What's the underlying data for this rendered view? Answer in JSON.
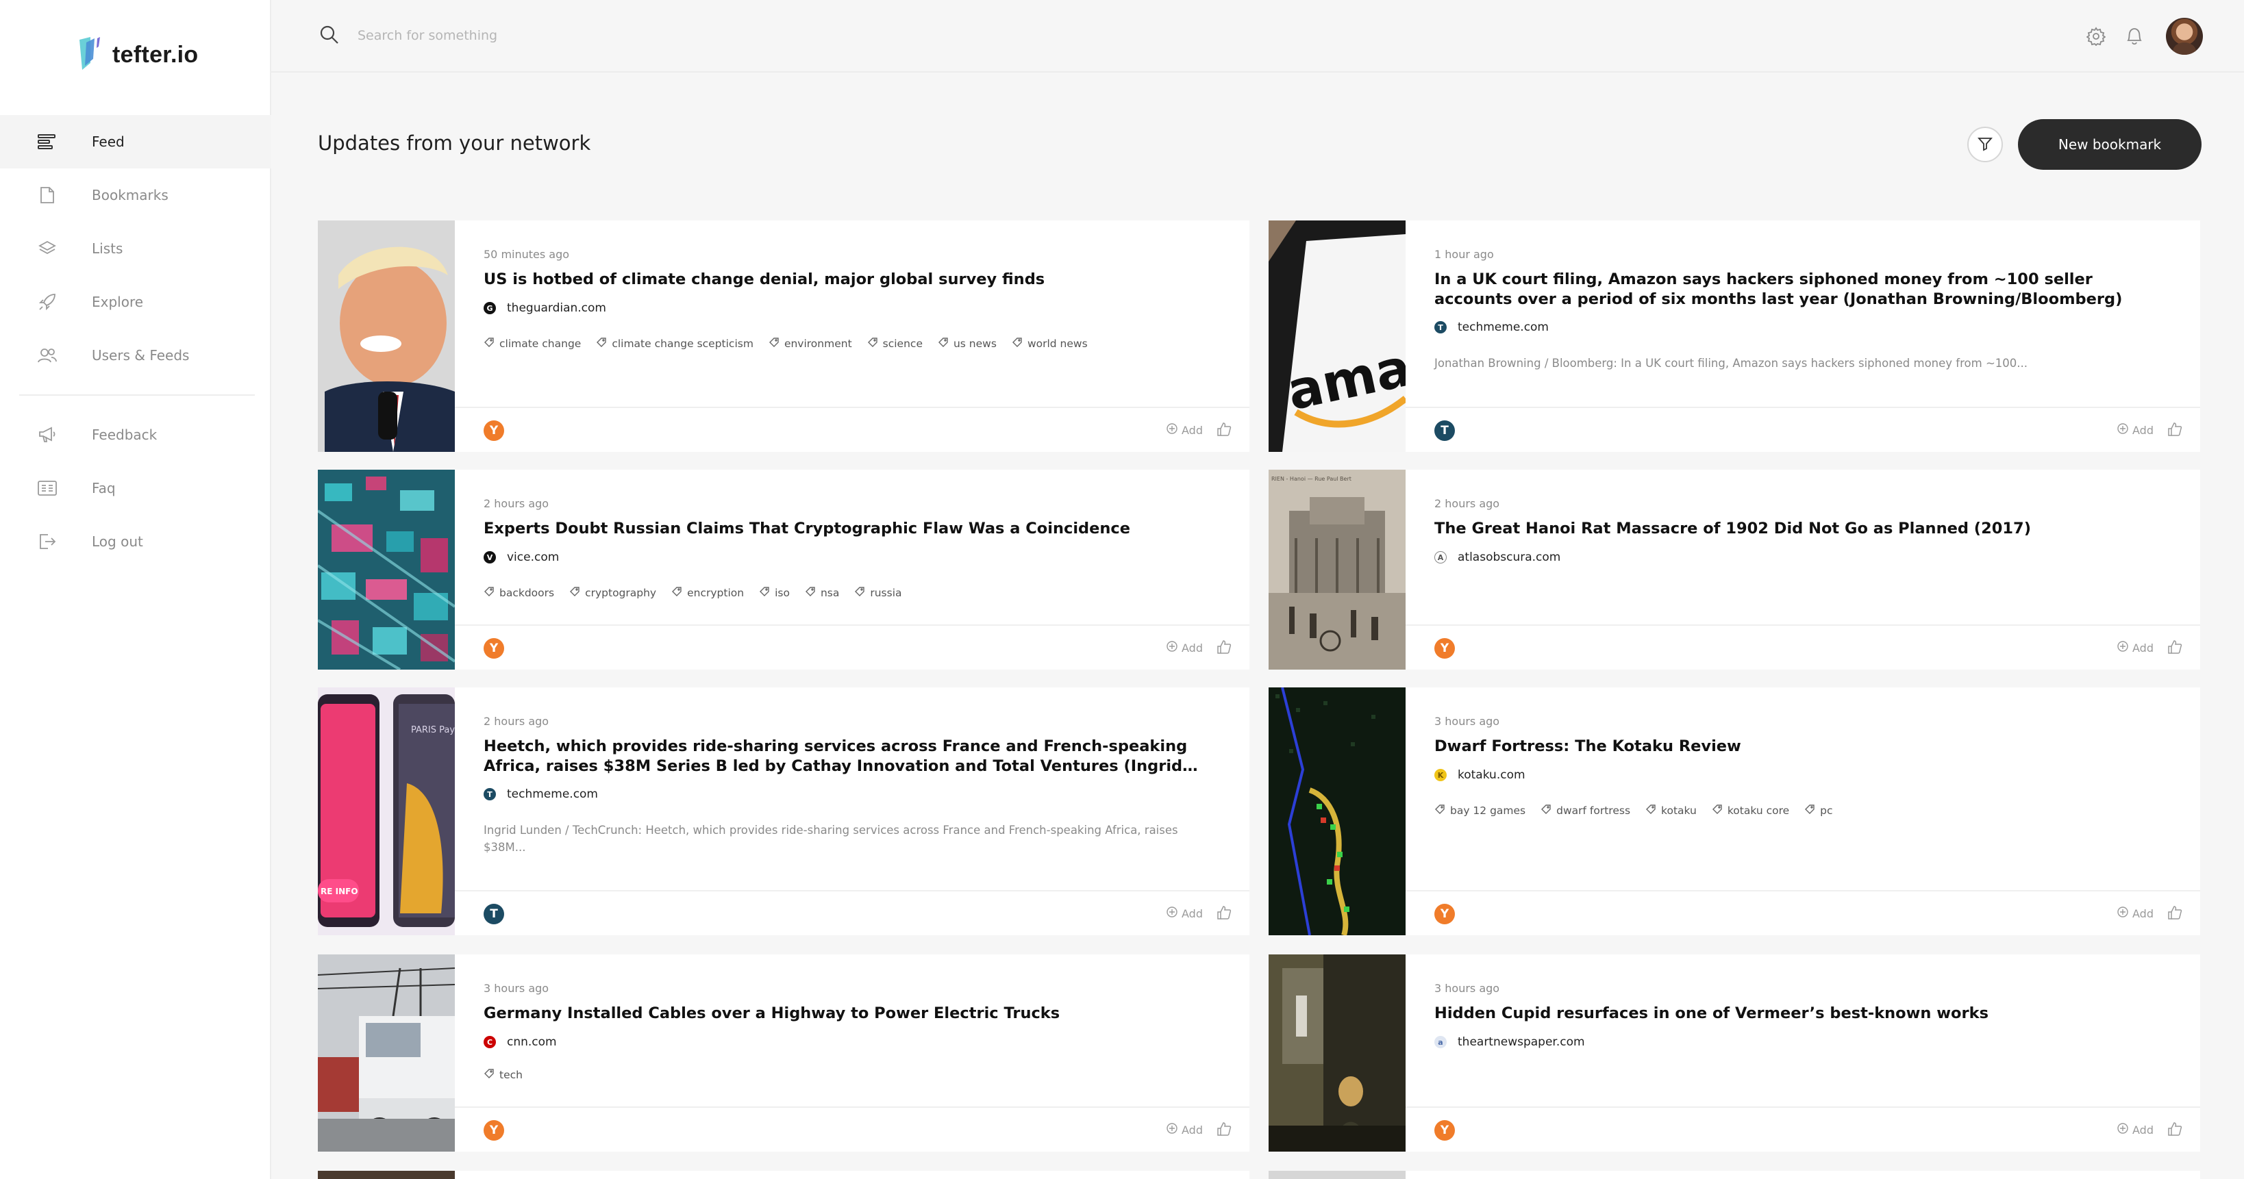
{
  "app": {
    "name": "tefter.io",
    "accent": "#2b2b2b",
    "badge_color": "#f07c2a"
  },
  "sidebar": {
    "items": [
      {
        "label": "Feed",
        "icon": "feed-icon"
      },
      {
        "label": "Bookmarks",
        "icon": "bookmark-icon"
      },
      {
        "label": "Lists",
        "icon": "layers-icon"
      },
      {
        "label": "Explore",
        "icon": "rocket-icon"
      },
      {
        "label": "Users & Feeds",
        "icon": "users-icon"
      }
    ],
    "secondary": [
      {
        "label": "Feedback",
        "icon": "megaphone-icon"
      },
      {
        "label": "Faq",
        "icon": "faq-icon"
      },
      {
        "label": "Log out",
        "icon": "logout-icon"
      }
    ]
  },
  "header": {
    "search_placeholder": "Search for something"
  },
  "page": {
    "title": "Updates from your network",
    "new_button": "New bookmark"
  },
  "cards": [
    {
      "time": "50 minutes ago",
      "title": "US is hotbed of climate change denial, major global survey finds",
      "source": "theguardian.com",
      "tags": [
        "climate change",
        "climate change scepticism",
        "environment",
        "science",
        "us news",
        "world news"
      ],
      "desc": "",
      "badge": "Y",
      "add": "Add"
    },
    {
      "time": "1 hour ago",
      "title": "In a UK court filing, Amazon says hackers siphoned money from ~100 seller accounts over a period of six months last year (Jonathan Browning/Bloomberg)",
      "source": "techmeme.com",
      "tags": [],
      "desc": "Jonathan Browning / Bloomberg: In a UK court filing, Amazon says hackers siphoned money from ~100...",
      "badge": "T",
      "add": "Add"
    },
    {
      "time": "2 hours ago",
      "title": "Experts Doubt Russian Claims That Cryptographic Flaw Was a Coincidence",
      "source": "vice.com",
      "tags": [
        "backdoors",
        "cryptography",
        "encryption",
        "iso",
        "nsa",
        "russia"
      ],
      "desc": "",
      "badge": "Y",
      "add": "Add"
    },
    {
      "time": "2 hours ago",
      "title": "The Great Hanoi Rat Massacre of 1902 Did Not Go as Planned (2017)",
      "source": "atlasobscura.com",
      "tags": [],
      "desc": "",
      "badge": "Y",
      "add": "Add"
    },
    {
      "time": "2 hours ago",
      "title": "Heetch, which provides ride-sharing services across France and French-speaking Africa, raises $38M Series B led by Cathay Innovation and Total Ventures (Ingrid…",
      "source": "techmeme.com",
      "tags": [],
      "desc": "Ingrid Lunden / TechCrunch: Heetch, which provides ride-sharing services across France and French-speaking Africa, raises $38M...",
      "badge": "T",
      "add": "Add"
    },
    {
      "time": "3 hours ago",
      "title": "Dwarf Fortress: The Kotaku Review",
      "source": "kotaku.com",
      "tags": [
        "bay 12 games",
        "dwarf fortress",
        "kotaku",
        "kotaku core",
        "pc"
      ],
      "desc": "",
      "badge": "Y",
      "add": "Add"
    },
    {
      "time": "3 hours ago",
      "title": "Germany Installed Cables over a Highway to Power Electric Trucks",
      "source": "cnn.com",
      "tags": [
        "tech"
      ],
      "desc": "",
      "badge": "Y",
      "add": "Add"
    },
    {
      "time": "3 hours ago",
      "title": "Hidden Cupid resurfaces in one of Vermeer’s best-known works",
      "source": "theartnewspaper.com",
      "tags": [],
      "desc": "",
      "badge": "Y",
      "add": "Add"
    }
  ],
  "thumb_text": {
    "amazon": "amaz",
    "hanoi": "RIEN - Hanoi — Rue Paul Bert",
    "heetch_left": "RE INFO",
    "heetch_right": "PARIS Pay in"
  }
}
